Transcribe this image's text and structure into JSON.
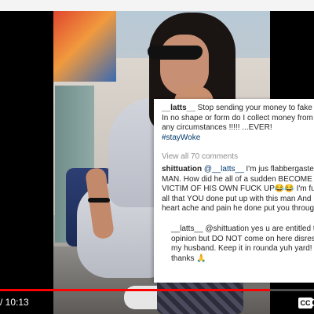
{
  "player": {
    "time_display": "/ 10:13",
    "progress_fraction": 0.86,
    "cc_label": "CC",
    "accent_color": "#ff0000",
    "gear_icon": "gear-icon"
  },
  "comments": {
    "c1": {
      "user": "__latts__",
      "line1": " Stop sending your money to fake a",
      "line2": "In no shape or form do I collect money from",
      "line3": "any circumstances !!!!! ...EVER!",
      "line4": "#stayWoke"
    },
    "view_all": "View all 70 comments",
    "c2": {
      "user": "shittuation",
      "line1_mid": " @__latts__ ",
      "line1_end": "I'm jus flabbergasted",
      "line2": "MAN. How did he all of a sudden BECOME T",
      "line3": "VICTIM OF HIS OWN FUCK UP😂😂 I'm fum",
      "line4": "all that YOU done put up with this man And",
      "line5": "heart ache and pain he done put you throug"
    },
    "reply": {
      "user": "__latts__",
      "line1_mid": " @shittuation ",
      "line1_end": "yes u are entitled t",
      "line2": "opinion but DO NOT come on here disres",
      "line3": "my husband. Keep it in rounda yuh yard!",
      "line4": "thanks 🙏"
    }
  }
}
